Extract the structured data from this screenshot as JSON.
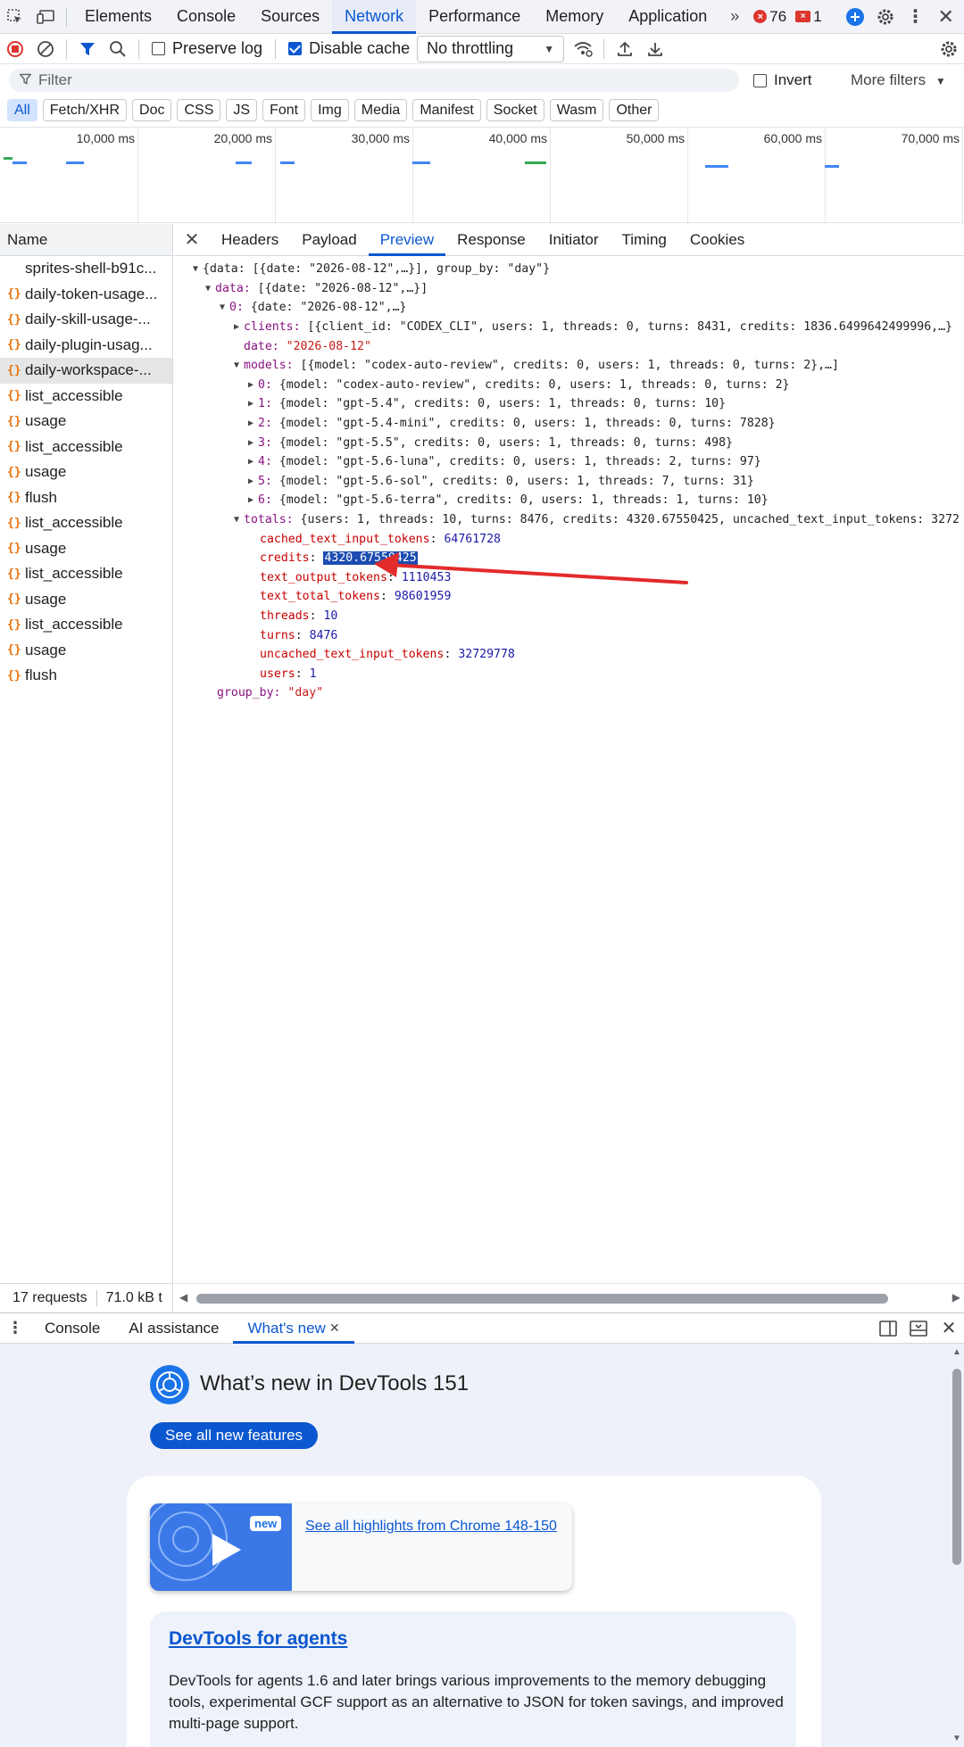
{
  "top_tabs": [
    "Elements",
    "Console",
    "Sources",
    "Network",
    "Performance",
    "Memory",
    "Application"
  ],
  "active_top_tab": "Network",
  "error_count": "76",
  "issue_count": "1",
  "toolbar": {
    "preserve_log": "Preserve log",
    "disable_cache": "Disable cache",
    "throttling": "No throttling"
  },
  "filter": {
    "placeholder": "Filter",
    "invert": "Invert",
    "more_filters": "More filters"
  },
  "type_chips": [
    "All",
    "Fetch/XHR",
    "Doc",
    "CSS",
    "JS",
    "Font",
    "Img",
    "Media",
    "Manifest",
    "Socket",
    "Wasm",
    "Other"
  ],
  "timeline_ticks": [
    "10,000 ms",
    "20,000 ms",
    "30,000 ms",
    "40,000 ms",
    "50,000 ms",
    "60,000 ms",
    "70,000 ms"
  ],
  "name_header": "Name",
  "requests": [
    {
      "label": "sprites-shell-b91c...",
      "icon": "none"
    },
    {
      "label": "daily-token-usage...",
      "icon": "json-icon"
    },
    {
      "label": "daily-skill-usage-...",
      "icon": "json-icon"
    },
    {
      "label": "daily-plugin-usag...",
      "icon": "json-icon"
    },
    {
      "label": "daily-workspace-...",
      "icon": "json-icon",
      "selected": true
    },
    {
      "label": "list_accessible",
      "icon": "json-icon"
    },
    {
      "label": "usage",
      "icon": "json-icon"
    },
    {
      "label": "list_accessible",
      "icon": "json-icon"
    },
    {
      "label": "usage",
      "icon": "json-icon"
    },
    {
      "label": "flush",
      "icon": "json-icon"
    },
    {
      "label": "list_accessible",
      "icon": "json-icon"
    },
    {
      "label": "usage",
      "icon": "json-icon"
    },
    {
      "label": "list_accessible",
      "icon": "json-icon"
    },
    {
      "label": "usage",
      "icon": "json-icon"
    },
    {
      "label": "list_accessible",
      "icon": "json-icon"
    },
    {
      "label": "usage",
      "icon": "json-icon"
    },
    {
      "label": "flush",
      "icon": "json-icon"
    }
  ],
  "status": {
    "requests": "17 requests",
    "transferred": "71.0 kB t"
  },
  "detail_tabs": [
    "Headers",
    "Payload",
    "Preview",
    "Response",
    "Initiator",
    "Timing",
    "Cookies"
  ],
  "active_detail_tab": "Preview",
  "preview": {
    "root": "{data: [{date: \"2026-08-12\",…}], group_by: \"day\"}",
    "data_summary": "[{date: \"2026-08-12\",…}]",
    "item0_summary": "{date: \"2026-08-12\",…}",
    "clients_summary": "[{client_id: \"CODEX_CLI\", users: 1, threads: 0, turns: 8431, credits: 1836.6499642499996,…}",
    "date_value": "\"2026-08-12\"",
    "models_summary": "[{model: \"codex-auto-review\", credits: 0, users: 1, threads: 0, turns: 2},…]",
    "models": [
      "{model: \"codex-auto-review\", credits: 0, users: 1, threads: 0, turns: 2}",
      "{model: \"gpt-5.4\", credits: 0, users: 1, threads: 0, turns: 10}",
      "{model: \"gpt-5.4-mini\", credits: 0, users: 1, threads: 0, turns: 7828}",
      "{model: \"gpt-5.5\", credits: 0, users: 1, threads: 0, turns: 498}",
      "{model: \"gpt-5.6-luna\", credits: 0, users: 1, threads: 2, turns: 97}",
      "{model: \"gpt-5.6-sol\", credits: 0, users: 1, threads: 7, turns: 31}",
      "{model: \"gpt-5.6-terra\", credits: 0, users: 1, threads: 1, turns: 10}"
    ],
    "totals_summary": "{users: 1, threads: 10, turns: 8476, credits: 4320.67550425, uncached_text_input_tokens: 3272",
    "totals": [
      {
        "key": "cached_text_input_tokens",
        "value": "64761728"
      },
      {
        "key": "credits",
        "value": "4320.67550425",
        "highlight": true
      },
      {
        "key": "text_output_tokens",
        "value": "1110453"
      },
      {
        "key": "text_total_tokens",
        "value": "98601959"
      },
      {
        "key": "threads",
        "value": "10"
      },
      {
        "key": "turns",
        "value": "8476"
      },
      {
        "key": "uncached_text_input_tokens",
        "value": "32729778"
      },
      {
        "key": "users",
        "value": "1"
      }
    ],
    "group_by_value": "\"day\""
  },
  "drawer": {
    "tabs": [
      "Console",
      "AI assistance",
      "What's new"
    ],
    "active_tab": "What's new",
    "title": "What’s new in DevTools 151",
    "button": "See all new features",
    "highlights_link": "See all highlights from Chrome 148-150",
    "new_badge": "new",
    "agents_title": "DevTools for agents",
    "agents_body": "DevTools for agents 1.6 and later brings various improvements to the memory debugging tools, experimental GCF support as an alternative to JSON for token savings, and improved multi-page support."
  },
  "colors": {
    "accent": "#0b57d0",
    "error": "#dc362e",
    "annotation_arrow": "#e32b2b",
    "json_icon": "#e8710a"
  }
}
